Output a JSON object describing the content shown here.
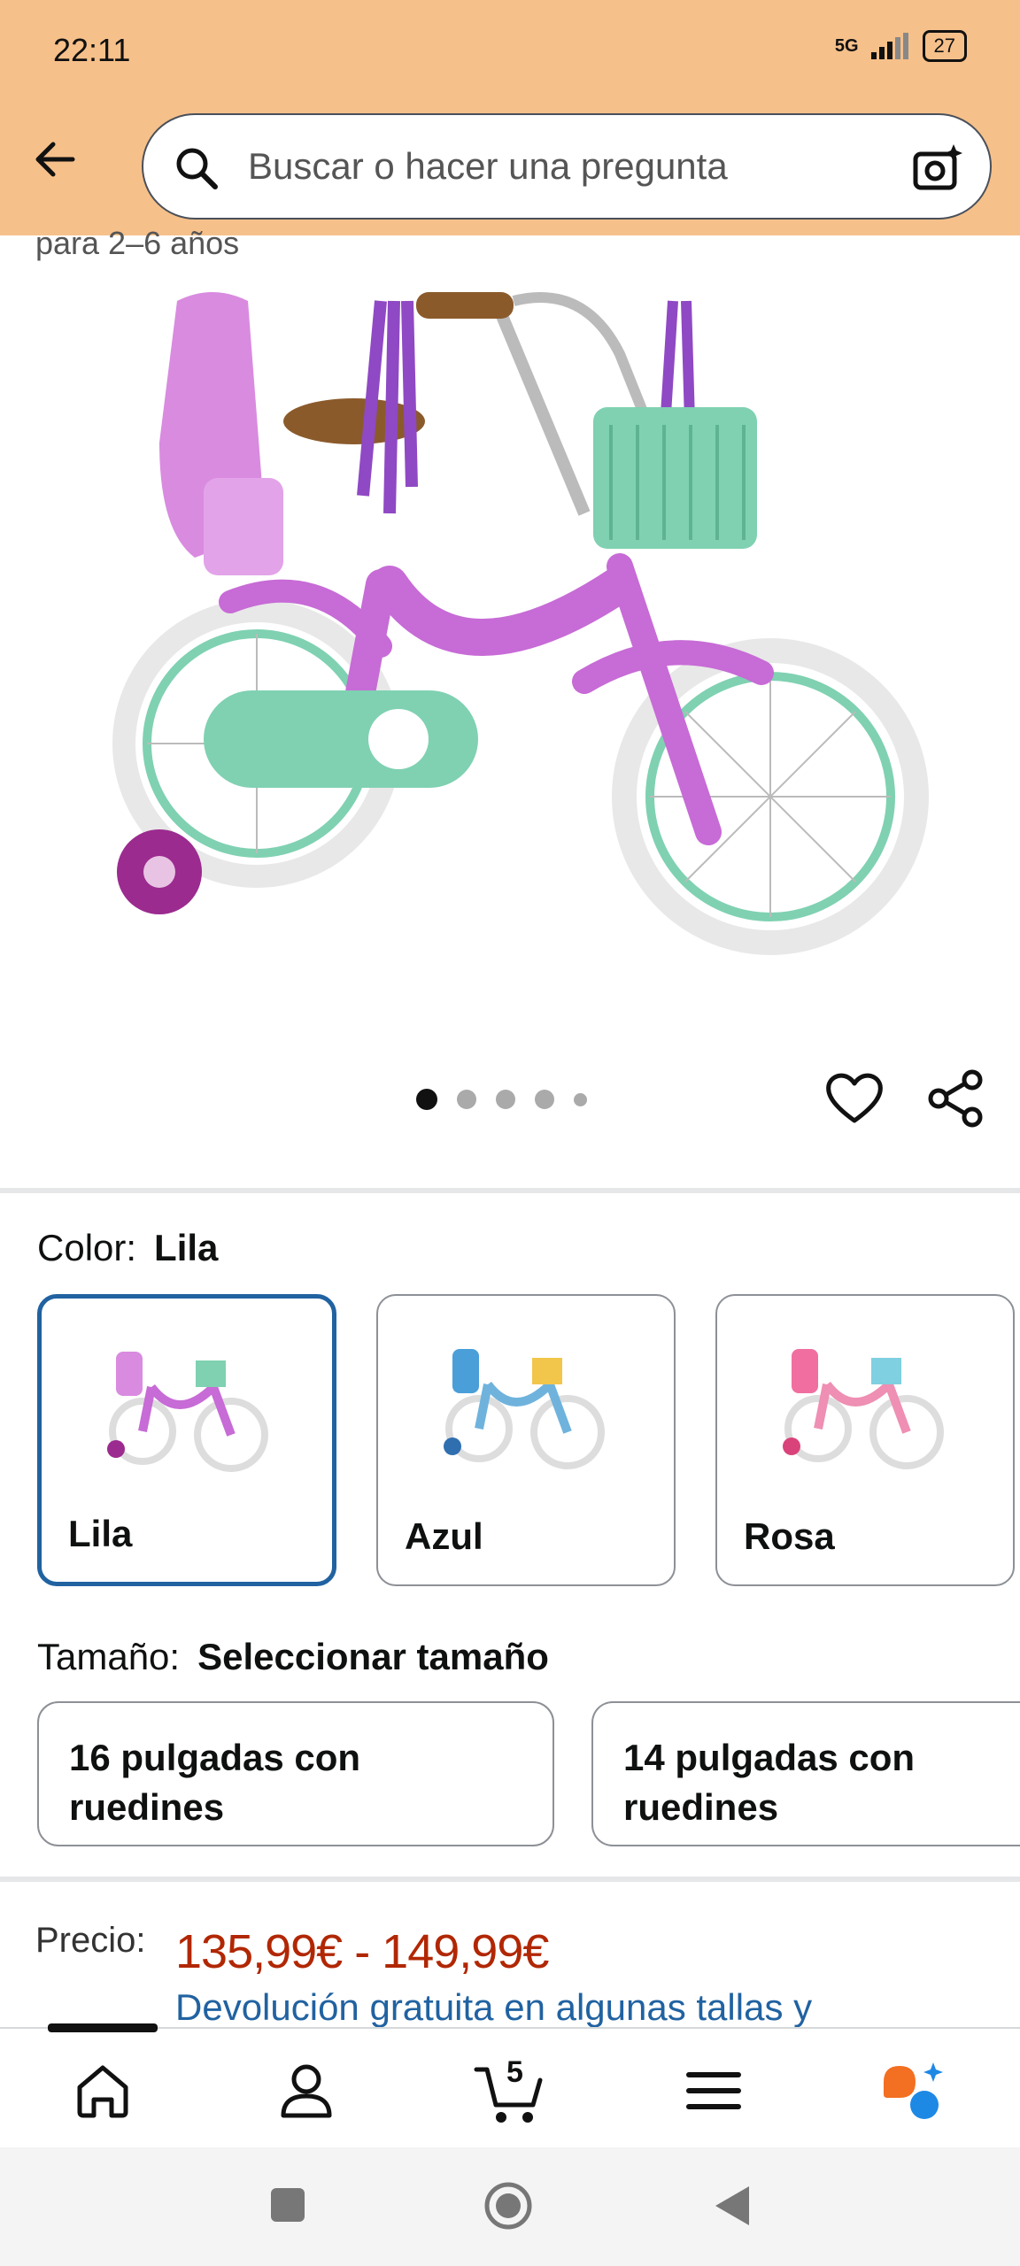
{
  "status_bar": {
    "time": "22:11",
    "signal": "5G",
    "battery": "27"
  },
  "search": {
    "placeholder": "Buscar o hacer una pregunta"
  },
  "product": {
    "subtitle_cut": "para 2–6 años",
    "carousel": {
      "count": 5,
      "active_index": 0
    }
  },
  "color": {
    "label": "Color:",
    "selected": "Lila",
    "options": [
      {
        "name": "Lila",
        "frame": "#c76bd6",
        "accent": "#7fd1b2"
      },
      {
        "name": "Azul",
        "frame": "#6fb3dd",
        "accent": "#f2c64b"
      },
      {
        "name": "Rosa",
        "frame": "#ee8fb3",
        "accent": "#7fd0e0"
      }
    ]
  },
  "size": {
    "label": "Tamaño:",
    "selected": "Seleccionar tamaño",
    "options": [
      {
        "line1": "16 pulgadas con",
        "line2": "ruedines"
      },
      {
        "line1": "14 pulgadas con",
        "line2": "ruedines"
      }
    ]
  },
  "price": {
    "label": "Precio:",
    "range": "135,99€ - 149,99€",
    "return_text": "Devolución gratuita en algunas tallas y"
  },
  "bottom_nav": {
    "cart_count": "5",
    "items": [
      "home-icon",
      "account-icon",
      "cart-icon",
      "menu-icon",
      "rufus-ai-icon"
    ]
  },
  "colors": {
    "header_bg": "#f6c08a",
    "price": "#b12704",
    "link": "#2162a1",
    "selected_border": "#2162a1"
  }
}
